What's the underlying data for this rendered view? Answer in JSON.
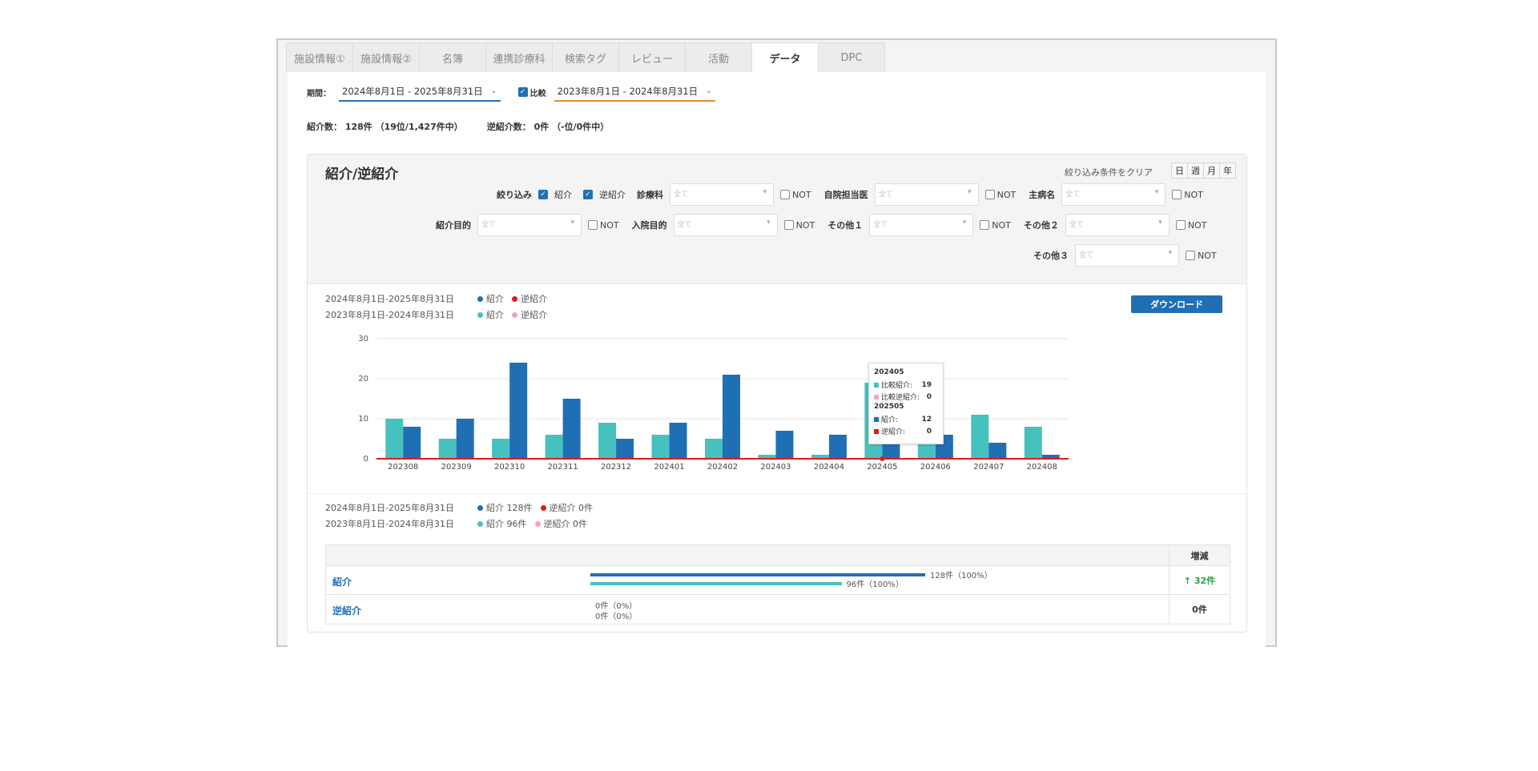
{
  "tabs": [
    {
      "label": "施設情報①",
      "active": false
    },
    {
      "label": "施設情報②",
      "active": false
    },
    {
      "label": "名簿",
      "active": false
    },
    {
      "label": "連携診療科",
      "active": false
    },
    {
      "label": "検索タグ",
      "active": false
    },
    {
      "label": "レビュー",
      "active": false
    },
    {
      "label": "活動",
      "active": false
    },
    {
      "label": "データ",
      "active": true
    },
    {
      "label": "DPC",
      "active": false
    }
  ],
  "filter": {
    "period_label": "期間：",
    "period_value": "2024年8月1日 - 2025年8月31日",
    "compare_label": "比較",
    "compare_value": "2023年8月1日 - 2024年8月31日",
    "chevron": "⌄"
  },
  "summary": {
    "referral": "紹介数： 128件 （19位/1,427件中）",
    "reverse": "逆紹介数： 0件 （-位/0件中）"
  },
  "panel": {
    "title": "紹介/逆紹介",
    "clear_filters": "絞り込み条件をクリア",
    "period_buttons": [
      "日",
      "週",
      "月",
      "年"
    ],
    "narrow_label": "絞り込み",
    "check_referral": "紹介",
    "check_reverse": "逆紹介",
    "select_placeholder": "全て",
    "not_label": "NOT",
    "fields": {
      "dept": "診療科",
      "doctor": "自院担当医",
      "disease": "主病名",
      "purpose": "紹介目的",
      "admission": "入院目的",
      "other1": "その他１",
      "other2": "その他２",
      "other3": "その他３"
    },
    "download": "ダウンロード"
  },
  "legend": {
    "current_period": "2024年8月1日-2025年8月31日",
    "compare_period": "2023年8月1日-2024年8月31日",
    "referral": "紹介",
    "reverse": "逆紹介",
    "sum_current_ref": "紹介 128件",
    "sum_current_rev": "逆紹介 0件",
    "sum_compare_ref": "紹介 96件",
    "sum_compare_rev": "逆紹介 0件"
  },
  "colors": {
    "current_referral": "#1f6fb5",
    "current_reverse": "#e01a1a",
    "compare_referral": "#45c2bf",
    "compare_reverse": "#f2a6b8",
    "increase": "#2e9e48"
  },
  "chart_data": {
    "type": "bar",
    "categories": [
      "202308",
      "202309",
      "202310",
      "202311",
      "202312",
      "202401",
      "202402",
      "202403",
      "202404",
      "202405",
      "202406",
      "202407",
      "202408"
    ],
    "series": [
      {
        "name": "比較紹介",
        "values": [
          10,
          5,
          5,
          6,
          9,
          6,
          5,
          1,
          1,
          19,
          10,
          11,
          8
        ]
      },
      {
        "name": "紹介",
        "values": [
          8,
          10,
          24,
          15,
          5,
          9,
          21,
          7,
          6,
          12,
          6,
          4,
          1
        ]
      },
      {
        "name": "逆紹介",
        "values": [
          0,
          0,
          0,
          0,
          0,
          0,
          0,
          0,
          0,
          0,
          0,
          0,
          0
        ]
      }
    ],
    "ylim": [
      0,
      30
    ],
    "yticks": [
      0,
      10,
      20,
      30
    ],
    "grid": true
  },
  "tooltip": {
    "compare_month": "202405",
    "compare_ref_label": "比較紹介:",
    "compare_ref_value": "19",
    "compare_rev_label": "比較逆紹介:",
    "compare_rev_value": "0",
    "current_month": "202505",
    "current_ref_label": "紹介:",
    "current_ref_value": "12",
    "current_rev_label": "逆紹介:",
    "current_rev_value": "0"
  },
  "table": {
    "header_diff": "増減",
    "rows": [
      {
        "name": "紹介",
        "current_label": "128件（100%）",
        "compare_label": "96件（100%）",
        "current_pct": 100,
        "compare_pct": 75,
        "diff": "↑ 32件"
      },
      {
        "name": "逆紹介",
        "current_label": "0件（0%）",
        "compare_label": "0件（0%）",
        "current_pct": 0,
        "compare_pct": 0,
        "diff": "0件"
      }
    ]
  }
}
